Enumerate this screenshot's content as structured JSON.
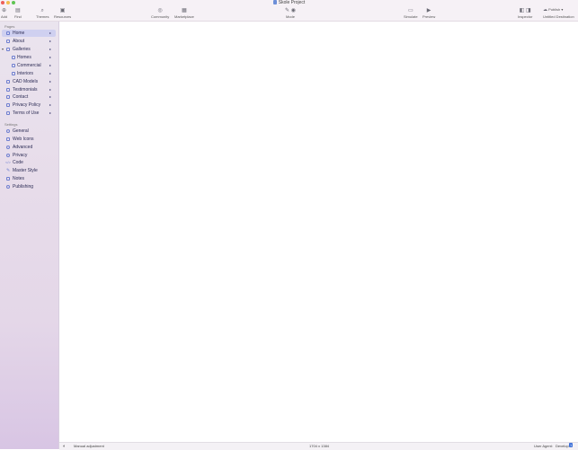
{
  "window": {
    "title": "Skole Project"
  },
  "toolbar": {
    "add": "Add",
    "find": "Find",
    "themes": "Themes",
    "resources": "Resources",
    "community": "Community",
    "marketplace": "Marketplace",
    "mode": "Mode",
    "simulate": "Simulate",
    "preview": "Preview",
    "inspector": "Inspector",
    "publish": "Publish",
    "destination": "Untitled Destination"
  },
  "sidebar": {
    "pages_header": "Pages",
    "pages": [
      {
        "label": "Home",
        "selected": true
      },
      {
        "label": "About"
      },
      {
        "label": "Galleries",
        "expanded": true
      },
      {
        "label": "Homes",
        "child": true
      },
      {
        "label": "Commercial",
        "child": true
      },
      {
        "label": "Interiors",
        "child": true
      },
      {
        "label": "CAD Models"
      },
      {
        "label": "Testimonials"
      },
      {
        "label": "Contact"
      },
      {
        "label": "Privacy Policy"
      },
      {
        "label": "Terms of Use"
      }
    ],
    "settings_header": "Settings",
    "settings": [
      {
        "label": "General"
      },
      {
        "label": "Web Icons"
      },
      {
        "label": "Advanced"
      },
      {
        "label": "Privacy"
      },
      {
        "label": "Code"
      },
      {
        "label": "Master Style"
      },
      {
        "label": "Notes"
      },
      {
        "label": "Publishing"
      }
    ]
  },
  "status": {
    "adjustment": "Manual adjustment",
    "dimensions": "1704 x 1384",
    "ua_label": "User Agent:",
    "ua_value": "Develop",
    "ua_badge": "1"
  },
  "colors": {
    "accent": "#3b6fd8",
    "selection": "#cfd0f0"
  }
}
